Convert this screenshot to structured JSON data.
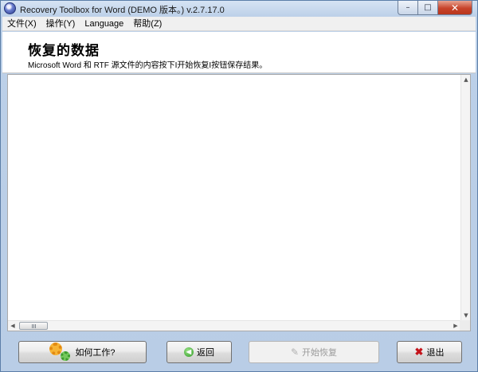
{
  "window": {
    "title": "Recovery Toolbox for Word (DEMO 版本。) v.2.7.17.0",
    "controls": {
      "minimize": "–",
      "maximize": "□",
      "close": "✕"
    }
  },
  "menu": {
    "items": [
      "文件(X)",
      "操作(Y)",
      "Language",
      "帮助(Z)"
    ]
  },
  "header": {
    "title": "恢复的数据",
    "subtitle": "Microsoft Word 和 RTF 源文件的内容按下I开始恢复I按钮保存结果。"
  },
  "scrollbars": {
    "up": "▲",
    "down": "▼",
    "left": "◀",
    "right": "▶"
  },
  "buttons": {
    "how_it_works": "如何工作?",
    "back": "返回",
    "back_glyph": "◀",
    "start_recovery": "开始恢复",
    "start_glyph": "✎",
    "exit": "退出",
    "exit_glyph": "✖"
  },
  "icons": {
    "app": "app-icon",
    "gears": "gears-icon",
    "back": "back-arrow-icon",
    "start": "pen-icon",
    "exit": "close-x-icon"
  }
}
